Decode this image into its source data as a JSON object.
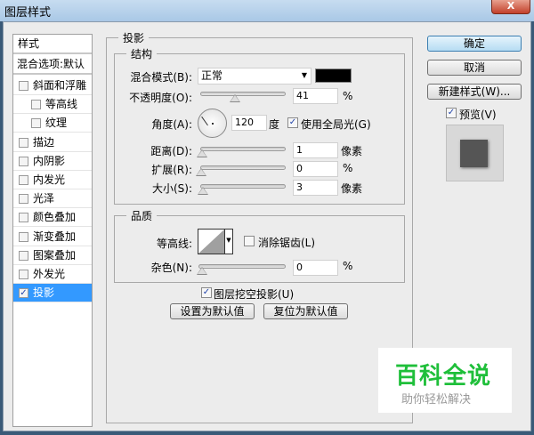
{
  "window": {
    "title": "图层样式",
    "close": "X"
  },
  "sidebar": {
    "header": "样式",
    "blend": "混合选项:默认",
    "items": [
      {
        "label": "斜面和浮雕",
        "checked": false,
        "indent": false
      },
      {
        "label": "等高线",
        "checked": false,
        "indent": true
      },
      {
        "label": "纹理",
        "checked": false,
        "indent": true
      },
      {
        "label": "描边",
        "checked": false,
        "indent": false
      },
      {
        "label": "内阴影",
        "checked": false,
        "indent": false
      },
      {
        "label": "内发光",
        "checked": false,
        "indent": false
      },
      {
        "label": "光泽",
        "checked": false,
        "indent": false
      },
      {
        "label": "颜色叠加",
        "checked": false,
        "indent": false
      },
      {
        "label": "渐变叠加",
        "checked": false,
        "indent": false
      },
      {
        "label": "图案叠加",
        "checked": false,
        "indent": false
      },
      {
        "label": "外发光",
        "checked": false,
        "indent": false
      },
      {
        "label": "投影",
        "checked": true,
        "indent": false,
        "selected": true
      }
    ]
  },
  "main": {
    "title": "投影",
    "structure": {
      "title": "结构",
      "blend_mode_label": "混合模式(B):",
      "blend_mode": "正常",
      "shadow_color": "#000000",
      "opacity_label": "不透明度(O):",
      "opacity": "41",
      "opacity_unit": "%",
      "angle_label": "角度(A):",
      "angle": "120",
      "angle_unit": "度",
      "global_light": "使用全局光(G)",
      "global_light_checked": true,
      "distance_label": "距离(D):",
      "distance": "1",
      "distance_unit": "像素",
      "spread_label": "扩展(R):",
      "spread": "0",
      "spread_unit": "%",
      "size_label": "大小(S):",
      "size": "3",
      "size_unit": "像素"
    },
    "quality": {
      "title": "品质",
      "contour_label": "等高线:",
      "antialias": "消除锯齿(L)",
      "antialias_checked": false,
      "noise_label": "杂色(N):",
      "noise": "0",
      "noise_unit": "%"
    },
    "knockout": "图层挖空投影(U)",
    "knockout_checked": true,
    "set_default": "设置为默认值",
    "reset_default": "复位为默认值"
  },
  "right": {
    "ok": "确定",
    "cancel": "取消",
    "new_style": "新建样式(W)...",
    "preview": "预览(V)",
    "preview_checked": true
  },
  "watermark": {
    "title": "百科全说",
    "subtitle": "助你轻松解决"
  }
}
